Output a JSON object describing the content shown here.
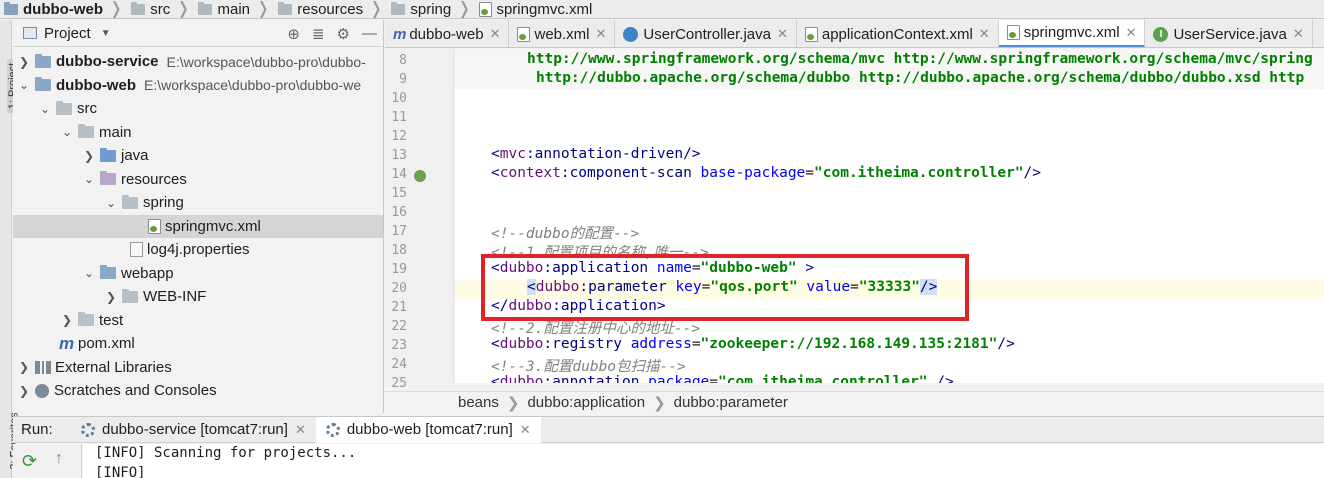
{
  "breadcrumb": [
    "dubbo-web",
    "src",
    "main",
    "resources",
    "spring",
    "springmvc.xml"
  ],
  "side_strip": {
    "project": "1: Project",
    "favorites": "2: Favorites"
  },
  "project_panel": {
    "title": "Project",
    "tree": [
      {
        "label": "dubbo-service",
        "path": "E:\\workspace\\dubbo-pro\\dubbo-",
        "bold": true
      },
      {
        "label": "dubbo-web",
        "path": "E:\\workspace\\dubbo-pro\\dubbo-we",
        "bold": true
      },
      {
        "label": "src"
      },
      {
        "label": "main"
      },
      {
        "label": "java"
      },
      {
        "label": "resources"
      },
      {
        "label": "spring"
      },
      {
        "label": "springmvc.xml",
        "selected": true
      },
      {
        "label": "log4j.properties"
      },
      {
        "label": "webapp"
      },
      {
        "label": "WEB-INF"
      },
      {
        "label": "test"
      },
      {
        "label": "pom.xml"
      },
      {
        "label": "External Libraries"
      },
      {
        "label": "Scratches and Consoles"
      }
    ]
  },
  "editor_tabs": [
    {
      "label": "dubbo-web",
      "icon": "maven-icon"
    },
    {
      "label": "web.xml",
      "icon": "xml-icon"
    },
    {
      "label": "UserController.java",
      "icon": "class-icon"
    },
    {
      "label": "applicationContext.xml",
      "icon": "xml-icon"
    },
    {
      "label": "springmvc.xml",
      "icon": "xml-icon",
      "active": true
    },
    {
      "label": "UserService.java",
      "icon": "interface-icon"
    }
  ],
  "line_numbers": [
    "8",
    "9",
    "10",
    "11",
    "12",
    "13",
    "14",
    "15",
    "16",
    "17",
    "18",
    "19",
    "20",
    "21",
    "22",
    "23",
    "24",
    "25"
  ],
  "code": {
    "l8": "http://www.springframework.org/schema/mvc http://www.springframework.org/schema/mvc/spring",
    "l9": "http://dubbo.apache.org/schema/dubbo http://dubbo.apache.org/schema/dubbo/dubbo.xsd http",
    "l13_ns": "mvc",
    "l13_tag": "annotation-driven",
    "l14_ns": "context",
    "l14_tag": "component-scan",
    "l14_attr": "base-package",
    "l14_val": "\"com.itheima.controller\"",
    "l17": "<!--dubbo的配置-->",
    "l18": "<!--1.配置项目的名称,唯一-->",
    "l19_ns": "dubbo",
    "l19_tag": "application",
    "l19_attr": "name",
    "l19_val": "\"dubbo-web\"",
    "l20_ns": "dubbo",
    "l20_tag": "parameter",
    "l20_attr1": "key",
    "l20_val1": "\"qos.port\"",
    "l20_attr2": "value",
    "l20_val2": "\"33333\"",
    "l21_ns": "dubbo",
    "l21_tag": "application",
    "l22": "<!--2.配置注册中心的地址-->",
    "l23_ns": "dubbo",
    "l23_tag": "registry",
    "l23_attr": "address",
    "l23_val": "\"zookeeper://192.168.149.135:2181\"",
    "l24": "<!--3.配置dubbo包扫描-->",
    "l25_ns": "dubbo",
    "l25_tag": "annotation",
    "l25_attr": "package",
    "l25_val": "\"com.itheima.controller\""
  },
  "editor_breadcrumbs": [
    "beans",
    "dubbo:application",
    "dubbo:parameter"
  ],
  "run_panel": {
    "label": "Run:",
    "tabs": [
      {
        "label": "dubbo-service [tomcat7:run]"
      },
      {
        "label": "dubbo-web [tomcat7:run]",
        "active": true
      }
    ],
    "console": [
      "[INFO] Scanning for projects...",
      "[INFO]"
    ]
  },
  "colors": {
    "highlight_box": "#e0232b",
    "active_tab_underline": "#4a8fd8"
  }
}
